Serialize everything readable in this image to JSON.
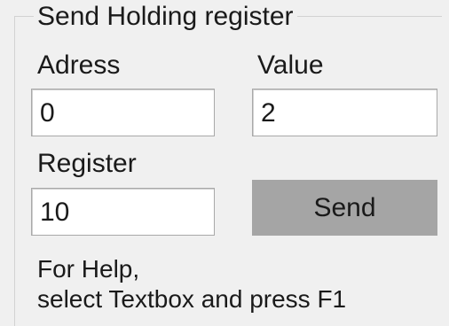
{
  "group": {
    "title": "Send Holding register"
  },
  "fields": {
    "address": {
      "label": "Adress",
      "value": "0"
    },
    "value": {
      "label": "Value",
      "value": "2"
    },
    "register": {
      "label": "Register",
      "value": "10"
    }
  },
  "send_button": {
    "label": "Send"
  },
  "help": {
    "line1": "For Help,",
    "line2": "select Textbox and press F1"
  }
}
